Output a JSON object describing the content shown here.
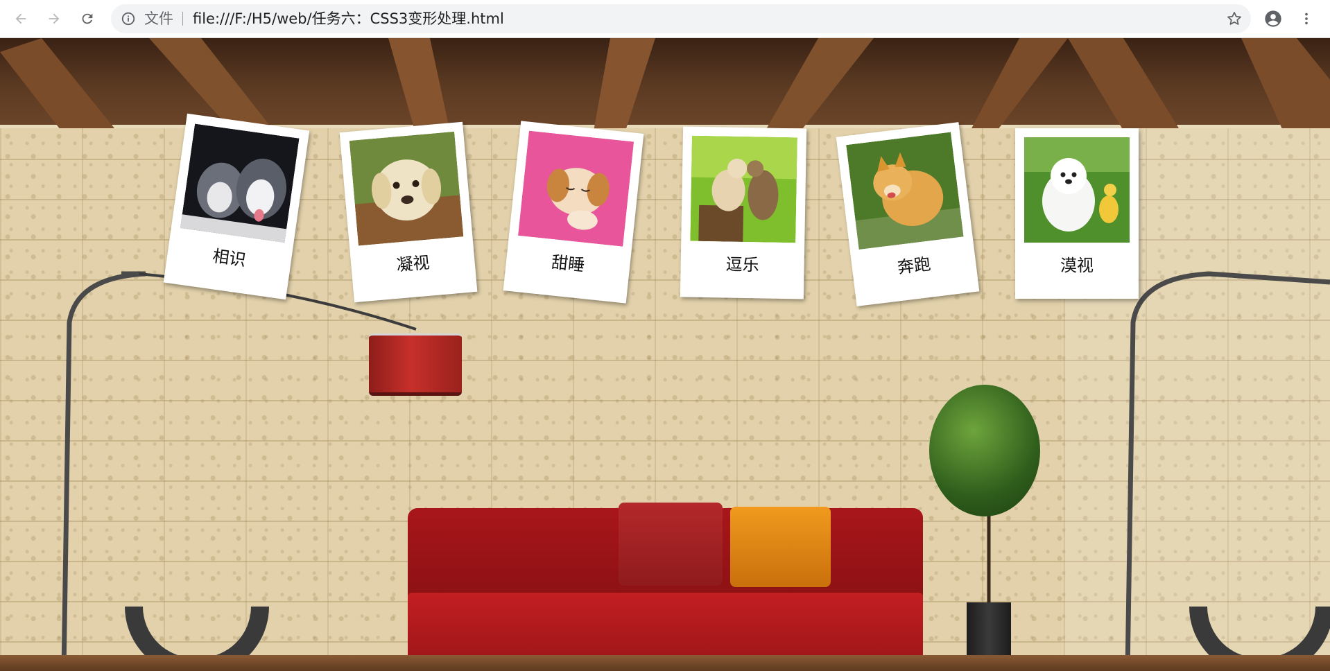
{
  "browser": {
    "back_icon": "arrow-left-icon",
    "forward_icon": "arrow-right-icon",
    "reload_icon": "reload-icon",
    "info_icon": "info-icon",
    "site_label": "文件",
    "url": "file:///F:/H5/web/任务六：CSS3变形处理.html",
    "star_icon": "star-outline-icon",
    "account_icon": "account-circle-icon",
    "menu_icon": "vertical-dots-icon"
  },
  "gallery": {
    "photos": [
      {
        "caption": "相识",
        "subject": "two husky puppies"
      },
      {
        "caption": "凝视",
        "subject": "labrador puppy"
      },
      {
        "caption": "甜睡",
        "subject": "sleeping puppy on pink fur"
      },
      {
        "caption": "逗乐",
        "subject": "two puppies playing"
      },
      {
        "caption": "奔跑",
        "subject": "shiba puppy running"
      },
      {
        "caption": "漠视",
        "subject": "white puppy with duckling"
      }
    ]
  }
}
